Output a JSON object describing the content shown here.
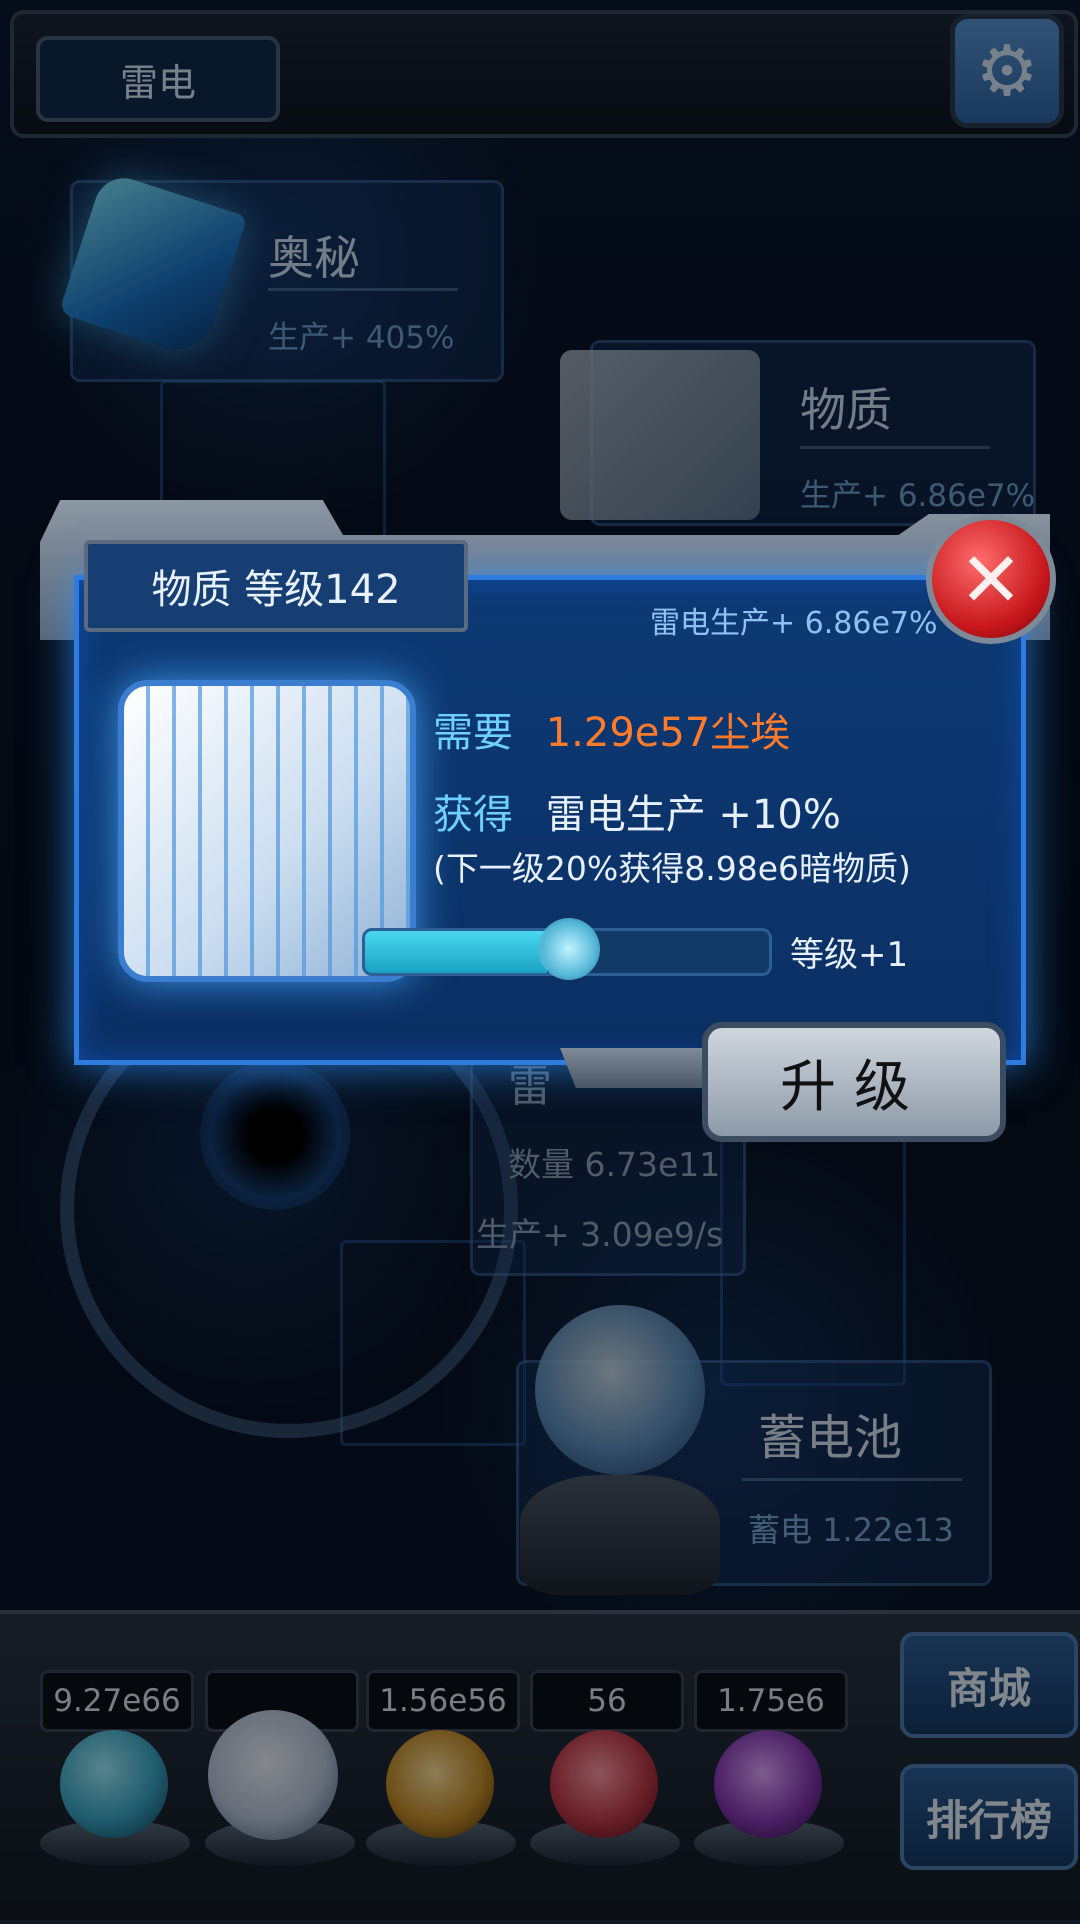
{
  "top_bar": {
    "title": "雷电"
  },
  "cards": {
    "mystery": {
      "title": "奥秘",
      "stat": "生产+ 405%"
    },
    "matter": {
      "title": "物质",
      "stat": "生产+ 6.86e7%"
    },
    "thunder": {
      "title": "雷",
      "count": "数量 6.73e11",
      "production": "生产+ 3.09e9/s"
    },
    "battery": {
      "title": "蓄电池",
      "stat": "蓄电 1.22e13"
    }
  },
  "dialog": {
    "title": "物质 等级142",
    "subtitle": "雷电生产+ 6.86e7%",
    "need_label": "需要",
    "need_value": "1.29e57尘埃",
    "gain_label": "获得",
    "gain_value": "雷电生产 +10%",
    "next_level_note": "(下一级20%获得8.98e6暗物质)",
    "progress": 0.45,
    "level_label": "等级+1",
    "upgrade_button": "升级",
    "close_icon": "close-x-icon"
  },
  "dock": {
    "resources": [
      {
        "value": "9.27e66",
        "icon": "atom-orb-icon",
        "color": "#3aa8c8"
      },
      {
        "value": "",
        "icon": "lightning-orb-icon",
        "color": "#b9c8dd"
      },
      {
        "value": "1.56e56",
        "icon": "dust-orb-icon",
        "color": "#c8902a"
      },
      {
        "value": "56",
        "icon": "dark-matter-orb-icon",
        "color": "#c23a4a"
      },
      {
        "value": "1.75e6",
        "icon": "vortex-orb-icon",
        "color": "#8a3ab8"
      }
    ],
    "shop_button": "商城",
    "rank_button": "排行榜"
  },
  "colors": {
    "accent": "#2e7ce0",
    "cost": "#ff7a2a",
    "label": "#6fd0ff"
  }
}
